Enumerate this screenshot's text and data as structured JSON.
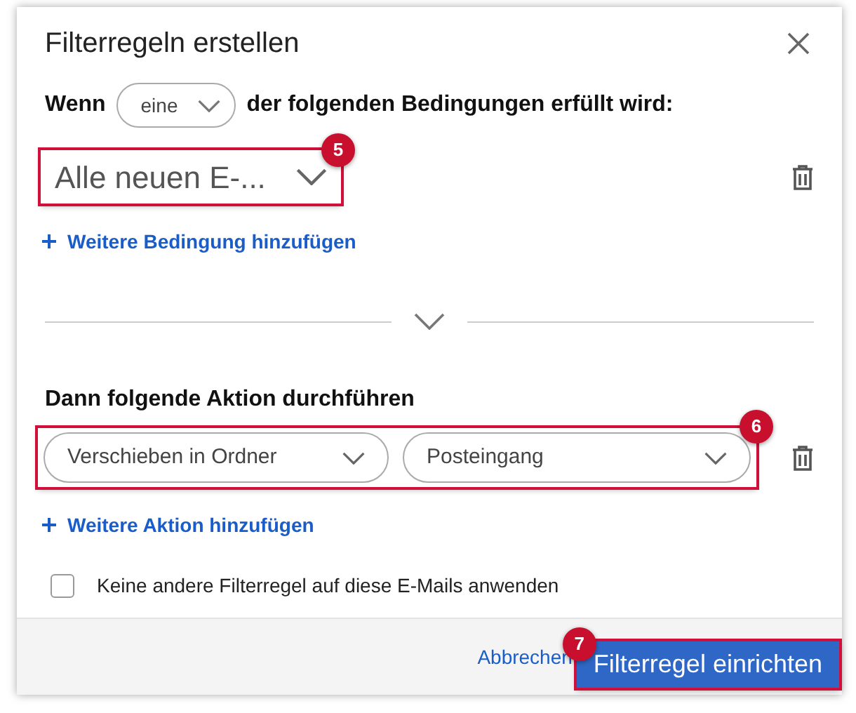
{
  "dialog": {
    "title": "Filterregeln erstellen"
  },
  "condition_sentence": {
    "prefix": "Wenn",
    "match_select": "eine",
    "suffix": "der folgenden Bedingungen erfüllt wird:"
  },
  "conditions": [
    {
      "value": "Alle neuen E-...",
      "highlighted": true,
      "badge": "5"
    }
  ],
  "add_condition": "Weitere Bedingung hinzufügen",
  "action_heading": "Dann folgende Aktion durchführen",
  "actions": [
    {
      "selects": [
        "Verschieben in Ordner",
        "Posteingang"
      ],
      "highlighted": true,
      "badge": "6"
    }
  ],
  "add_action": "Weitere Aktion hinzufügen",
  "stop_option": {
    "label": "Keine andere Filterregel auf diese E-Mails anwenden",
    "checked": false
  },
  "footer": {
    "cancel": "Abbrechen",
    "submit": "Filterregel einrichten",
    "submit_highlighted": true,
    "submit_badge": "7"
  }
}
